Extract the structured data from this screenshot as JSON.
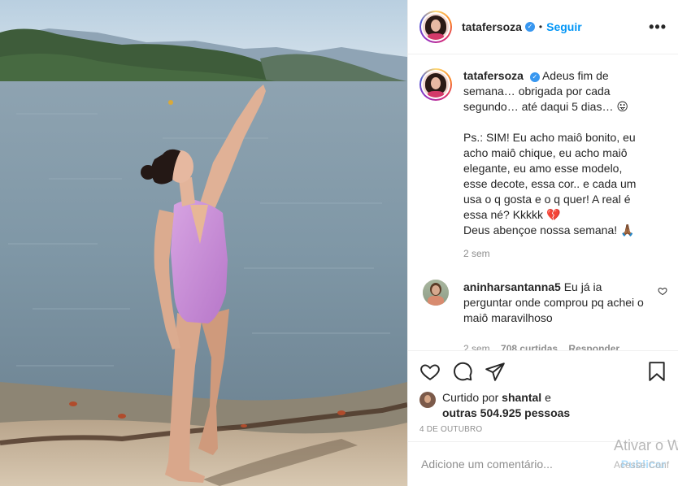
{
  "post": {
    "username": "tatafersoza",
    "follow_label": "Seguir",
    "separator": "•",
    "more_label": "•••",
    "verified_mark": "✓"
  },
  "caption": {
    "username": "tatafersoza",
    "text": "Adeus fim de semana… obrigada por cada segundo… até daqui 5 dias… 😛\n\nPs.: SIM! Eu acho maiô bonito, eu acho maiô chique, eu acho maiô elegante, eu amo esse modelo, esse decote, essa cor.. e cada um usa o q gosta e o q quer! A real é essa né? Kkkkk 💔\nDeus abençoe nossa semana! 🙏🏾",
    "time": "2 sem"
  },
  "comment": {
    "username": "aninharsantanna5",
    "text": "Eu já ia perguntar onde comprou pq achei o maiô maravilhoso",
    "time": "2 sem",
    "likes": "708 curtidas",
    "reply_label": "Responder"
  },
  "likes": {
    "prefix": "Curtido por",
    "user": "shantal",
    "mid": "e",
    "others": "outras 504.925 pessoas"
  },
  "date": "4 DE OUTUBRO",
  "add_comment": {
    "placeholder": "Adicione um comentário...",
    "post_label": "Publicar"
  },
  "watermark": {
    "line1": "Ativar o W",
    "line2": "Acesse Conf"
  },
  "icons": {
    "like": "heart-icon",
    "comment": "comment-icon",
    "share": "share-icon",
    "save": "bookmark-icon",
    "verified": "verified-badge-icon"
  },
  "colors": {
    "follow": "#0095f6",
    "verified": "#3897f0",
    "meta": "#8e8e8e",
    "swimsuit": "#c98fd6"
  }
}
